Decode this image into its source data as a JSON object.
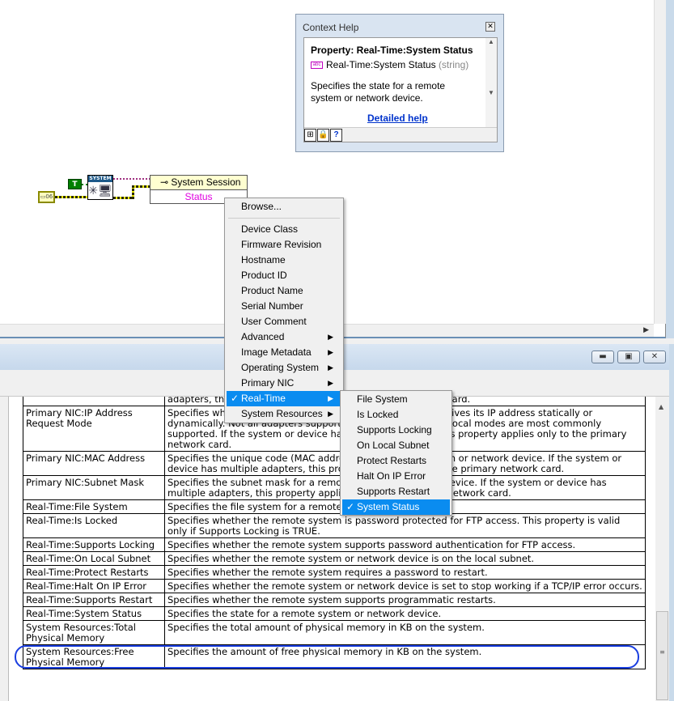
{
  "context_help": {
    "title": "Context Help",
    "property_heading": "Property:  Real-Time:System Status",
    "type_name": "Real-Time:System Status",
    "type_suffix": "(string)",
    "description": "Specifies the state for a remote system or network device.",
    "link": "Detailed help"
  },
  "diagram": {
    "system_node_label": "SYSTEM",
    "bool_constant": "T",
    "property_node_class": "System Session",
    "property_node_item": "Status"
  },
  "context_menu": {
    "items": [
      {
        "label": "Browse..."
      },
      {
        "label": "Device Class"
      },
      {
        "label": "Firmware Revision"
      },
      {
        "label": "Hostname"
      },
      {
        "label": "Product ID"
      },
      {
        "label": "Product Name"
      },
      {
        "label": "Serial Number"
      },
      {
        "label": "User Comment"
      },
      {
        "label": "Advanced",
        "submenu": true
      },
      {
        "label": "Image Metadata",
        "submenu": true
      },
      {
        "label": "Operating System",
        "submenu": true
      },
      {
        "label": "Primary NIC",
        "submenu": true
      },
      {
        "label": "Real-Time",
        "submenu": true,
        "selected": true
      },
      {
        "label": "System Resources",
        "submenu": true
      }
    ],
    "submenu": [
      {
        "label": "File System"
      },
      {
        "label": "Is Locked"
      },
      {
        "label": "Supports Locking"
      },
      {
        "label": "On Local Subnet"
      },
      {
        "label": "Protect Restarts"
      },
      {
        "label": "Halt On IP Error"
      },
      {
        "label": "Supports Restart"
      },
      {
        "label": "System Status",
        "selected": true
      }
    ]
  },
  "help_table": {
    "rows": [
      {
        "name": "",
        "desc": "adapters, this property applies only to the primary network card."
      },
      {
        "name": "Primary NIC:IP Address Request Mode",
        "desc": "Specifies whether the remote system or network device receives its IP address statically or dynamically. Not all adapters support all modes; DHCP/Link-Local modes are most commonly supported. If the system or device has multiple adapters, this property applies only to the primary network card."
      },
      {
        "name": "Primary NIC:MAC Address",
        "desc": "Specifies the unique code (MAC address) for a remote system or network device. If the system or device has multiple adapters, this property applies only to the primary network card."
      },
      {
        "name": "Primary NIC:Subnet Mask",
        "desc": "Specifies the subnet mask for a remote system or network device. If the system or device has multiple adapters, this property applies only to the primary network card."
      },
      {
        "name": "Real-Time:File System",
        "desc": "Specifies the file system for a remote system."
      },
      {
        "name": "Real-Time:Is Locked",
        "desc": "Specifies whether the remote system is password protected for FTP access. This property is valid only if Supports Locking is TRUE."
      },
      {
        "name": "Real-Time:Supports Locking",
        "desc": "Specifies whether the remote system supports password authentication for FTP access."
      },
      {
        "name": "Real-Time:On Local Subnet",
        "desc": "Specifies whether the remote system or network device is on the local subnet."
      },
      {
        "name": "Real-Time:Protect Restarts",
        "desc": "Specifies whether the remote system requires a password to restart."
      },
      {
        "name": "Real-Time:Halt On IP Error",
        "desc": "Specifies whether the remote system or network device is set to stop working if a TCP/IP error occurs."
      },
      {
        "name": "Real-Time:Supports Restart",
        "desc": "Specifies whether the remote system supports programmatic restarts."
      },
      {
        "name": "Real-Time:System Status",
        "desc": "Specifies the state for a remote system or network device."
      },
      {
        "name": "System Resources:Total Physical Memory",
        "desc": "Specifies the total amount of physical memory in KB on the system."
      },
      {
        "name": "System Resources:Free Physical Memory",
        "desc": "Specifies the amount of free physical memory in KB on the system."
      }
    ]
  },
  "colors": {
    "menu_highlight": "#0a8cf0",
    "annotation_ellipse": "#1a3ee0"
  }
}
